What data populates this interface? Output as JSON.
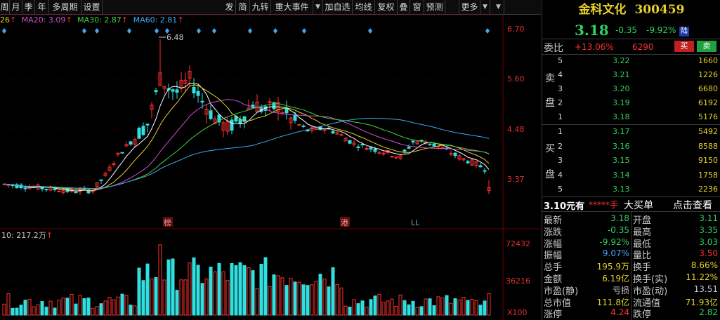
{
  "toolbar": {
    "left": [
      "周",
      "月",
      "季",
      "年",
      "多周期",
      "设置"
    ],
    "right": [
      "发",
      "简",
      "九转",
      "重大事件",
      "加自选",
      "均线",
      "复权",
      "叠",
      "窗",
      "预测",
      "更多"
    ]
  },
  "ma_legend": [
    {
      "label": "26",
      "color": "#e8d028"
    },
    {
      "label": "MA20: 3.09",
      "color": "#d050d0"
    },
    {
      "label": "MA30: 2.87",
      "color": "#40d040"
    },
    {
      "label": "MA60: 2.81",
      "color": "#40a8f0"
    }
  ],
  "price_axis": [
    "6.70",
    "5.60",
    "4.48",
    "3.37"
  ],
  "volume_axis": [
    "72432",
    "36216",
    "X100"
  ],
  "chart_annotations": {
    "high_label": "6.48",
    "markers": [
      "榜",
      "港",
      "LL"
    ],
    "volume_legend": "10: 217.2万"
  },
  "colors": {
    "up": "#ff3030",
    "down": "#30e0e0",
    "yellow": "#e8d028",
    "green": "#2fd060",
    "grid": "#3a0000"
  },
  "chart_data": {
    "type": "candlestick",
    "high_marker": 6.48,
    "price_ticks": [
      6.7,
      5.6,
      4.48,
      3.37
    ],
    "volume_ticks": [
      72432,
      36216
    ],
    "moving_averages": {
      "MA20": 3.09,
      "MA30": 2.87,
      "MA60": 2.81
    }
  },
  "panel": {
    "name": "金科文化",
    "code": "300459",
    "price": "3.18",
    "change": "-0.35",
    "change_pct": "-9.92%",
    "hk_badge": "陆",
    "weibi_label": "委比",
    "weibi_val": "+13.06%",
    "weicha_val": "6290",
    "buy_btn": "买",
    "sell_btn": "卖",
    "sell_side_label": [
      "卖",
      "盘"
    ],
    "buy_side_label": [
      "买",
      "盘"
    ],
    "asks": [
      {
        "lvl": "5",
        "price": "3.22",
        "vol": "1660"
      },
      {
        "lvl": "4",
        "price": "3.21",
        "vol": "1226"
      },
      {
        "lvl": "3",
        "price": "3.20",
        "vol": "6680"
      },
      {
        "lvl": "2",
        "price": "3.19",
        "vol": "6192"
      },
      {
        "lvl": "1",
        "price": "3.18",
        "vol": "5176"
      }
    ],
    "bids": [
      {
        "lvl": "1",
        "price": "3.17",
        "vol": "5492"
      },
      {
        "lvl": "2",
        "price": "3.16",
        "vol": "8588"
      },
      {
        "lvl": "3",
        "price": "3.15",
        "vol": "9150"
      },
      {
        "lvl": "4",
        "price": "3.14",
        "vol": "1758"
      },
      {
        "lvl": "5",
        "price": "3.13",
        "vol": "2236"
      }
    ],
    "promo": {
      "price": "3.10元有",
      "stars": "*****手",
      "big": "大买单",
      "link": "点击查看"
    },
    "stats": [
      {
        "l1": "最新",
        "v1": "3.18",
        "c1": "#2fd060",
        "l2": "开盘",
        "v2": "3.11",
        "c2": "#2fd060"
      },
      {
        "l1": "涨跌",
        "v1": "-0.35",
        "c1": "#2fd060",
        "l2": "最高",
        "v2": "3.35",
        "c2": "#2fd060"
      },
      {
        "l1": "涨幅",
        "v1": "-9.92%",
        "c1": "#2fd060",
        "l2": "最低",
        "v2": "3.03",
        "c2": "#2fd060"
      },
      {
        "l1": "振幅",
        "v1": "9.07%",
        "c1": "#40a8f0",
        "l2": "量比",
        "v2": "3.50",
        "c2": "#ff3030"
      },
      {
        "l1": "总手",
        "v1": "195.9万",
        "c1": "#e8d028",
        "l2": "换手",
        "v2": "8.66%",
        "c2": "#e8d028"
      },
      {
        "l1": "金额",
        "v1": "6.19亿",
        "c1": "#e8d028",
        "l2": "换手(实)",
        "v2": "11.22%",
        "c2": "#e8d028"
      },
      {
        "l1": "市盈(静)",
        "v1": "亏损",
        "c1": "#c8c8c8",
        "l2": "市盈(动)",
        "v2": "13.51",
        "c2": "#c8c8c8"
      },
      {
        "l1": "总市值",
        "v1": "111.8亿",
        "c1": "#e8d028",
        "l2": "流通值",
        "v2": "71.93亿",
        "c2": "#e8d028"
      },
      {
        "l1": "涨停",
        "v1": "4.24",
        "c1": "#ff3030",
        "l2": "跌停",
        "v2": "2.82",
        "c2": "#2fd060"
      }
    ]
  }
}
